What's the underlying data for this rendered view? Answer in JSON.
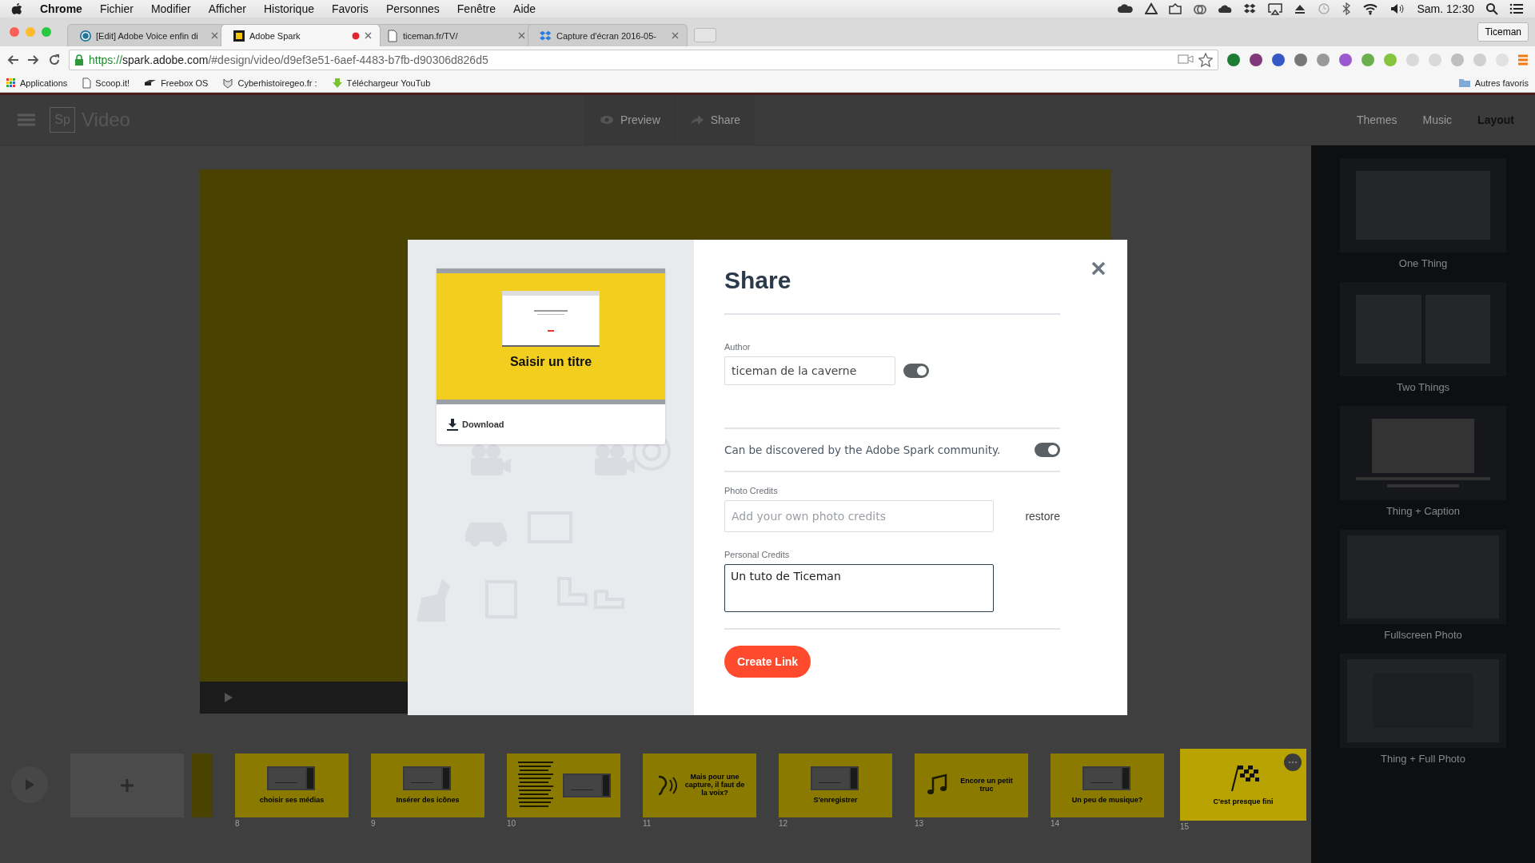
{
  "menubar": {
    "app": "Chrome",
    "menus": [
      "Fichier",
      "Modifier",
      "Afficher",
      "Historique",
      "Favoris",
      "Personnes",
      "Fenêtre",
      "Aide"
    ],
    "clock": "Sam. 12:30"
  },
  "browser": {
    "tabs": [
      {
        "title": "[Edit] Adobe Voice enfin di",
        "kind": "wordpress",
        "selected": false,
        "recording": false
      },
      {
        "title": "Adobe Spark",
        "kind": "spark",
        "selected": true,
        "recording": true
      },
      {
        "title": "ticeman.fr/TV/",
        "kind": "page",
        "selected": false,
        "recording": false
      },
      {
        "title": "Capture d'écran 2016-05-",
        "kind": "dropbox",
        "selected": false,
        "recording": false
      }
    ],
    "profile": "Ticeman",
    "url": {
      "scheme": "https://",
      "host": "spark.adobe.com",
      "path": "/#design/video/d9ef3e51-6aef-4483-b7fb-d90306d826d5"
    },
    "bookmarks": [
      {
        "label": "Applications",
        "kind": "apps"
      },
      {
        "label": "Scoop.it!",
        "kind": "page"
      },
      {
        "label": "Freebox OS",
        "kind": "box"
      },
      {
        "label": "Cyberhistoiregeo.fr :",
        "kind": "cat"
      },
      {
        "label": "Téléchargeur YouTub",
        "kind": "download"
      }
    ],
    "other_bookmarks": "Autres favoris"
  },
  "app_header": {
    "logo": "Sp",
    "title": "Video",
    "actions": [
      {
        "label": "Preview",
        "kind": "eye"
      },
      {
        "label": "Share",
        "kind": "share"
      }
    ],
    "tabs": [
      {
        "label": "Themes",
        "selected": false
      },
      {
        "label": "Music",
        "selected": false
      },
      {
        "label": "Layout",
        "selected": true
      }
    ]
  },
  "layouts": [
    {
      "label": "One Thing",
      "kind": "one"
    },
    {
      "label": "Two Things",
      "kind": "two"
    },
    {
      "label": "Thing + Caption",
      "kind": "caption"
    },
    {
      "label": "Fullscreen Photo",
      "kind": "full"
    },
    {
      "label": "Thing + Full Photo",
      "kind": "fullthing"
    }
  ],
  "filmstrip": {
    "slides": [
      {
        "kind": "screen",
        "caption": "choisir ses médias",
        "number": "8",
        "selected": false
      },
      {
        "kind": "screen",
        "caption": "Insérer des icônes",
        "number": "9",
        "selected": false
      },
      {
        "kind": "text",
        "number": "10",
        "selected": false
      },
      {
        "kind": "voice",
        "caption": "Mais pour une capture, il faut de la voix?",
        "number": "11",
        "selected": false
      },
      {
        "kind": "screen",
        "caption": "S'enregistrer",
        "number": "12",
        "selected": false
      },
      {
        "kind": "music",
        "caption": "Encore un petit truc",
        "number": "13",
        "selected": false
      },
      {
        "kind": "screen",
        "caption": "Un peu de musique?",
        "number": "14",
        "selected": false
      },
      {
        "kind": "flag",
        "caption": "C'est presque fini",
        "number": "15",
        "selected": true
      }
    ]
  },
  "share_dialog": {
    "preview": {
      "title": "Saisir un titre",
      "download": "Download"
    },
    "title": "Share",
    "author": {
      "label": "Author",
      "value": "ticeman de la caverne",
      "on": true
    },
    "discover": {
      "label": "Can be discovered by the Adobe Spark community.",
      "on": true
    },
    "photo_credits": {
      "label": "Photo Credits",
      "placeholder": "Add your own photo credits",
      "restore": "restore"
    },
    "personal_credits": {
      "label": "Personal Credits",
      "value": "Un tuto de Ticeman"
    },
    "button": "Create Link"
  }
}
